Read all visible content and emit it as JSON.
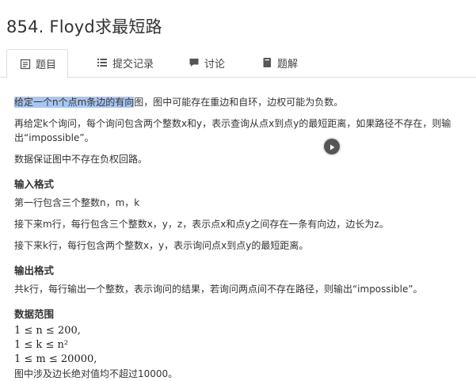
{
  "page": {
    "title": "854. Floyd求最短路"
  },
  "tabs": [
    {
      "label": "题目",
      "icon": "document-icon"
    },
    {
      "label": "提交记录",
      "icon": "list-icon"
    },
    {
      "label": "讨论",
      "icon": "chat-icon"
    },
    {
      "label": "题解",
      "icon": "book-icon"
    }
  ],
  "problem": {
    "p1_highlight": "给定一个n个点m条边的有向",
    "p1_rest": "图，图中可能存在重边和自环，边权可能为负数。",
    "p2": "再给定k个询问，每个询问包含两个整数x和y，表示查询从点x到点y的最短距离，如果路径不存在，则输出“impossible”。",
    "p3": "数据保证图中不存在负权回路。",
    "input_title": "输入格式",
    "input_1": "第一行包含三个整数n，m，k",
    "input_2": "接下来m行，每行包含三个整数x，y，z，表示点x和点y之间存在一条有向边，边长为z。",
    "input_3": "接下来k行，每行包含两个整数x，y，表示询问点x到点y的最短距离。",
    "output_title": "输出格式",
    "output_1": "共k行，每行输出一个整数，表示询问的结果，若询问两点间不存在路径，则输出“impossible”。",
    "range_title": "数据范围",
    "range_1": "1 ≤ n ≤ 200,",
    "range_2": "1 ≤ k ≤ n²",
    "range_3": "1 ≤ m ≤ 20000,",
    "range_4": "图中涉及边长绝对值均不超过10000。"
  },
  "colors": {
    "highlight": "#a9c6f0",
    "tab_border": "#dddddd",
    "text": "#333333"
  }
}
